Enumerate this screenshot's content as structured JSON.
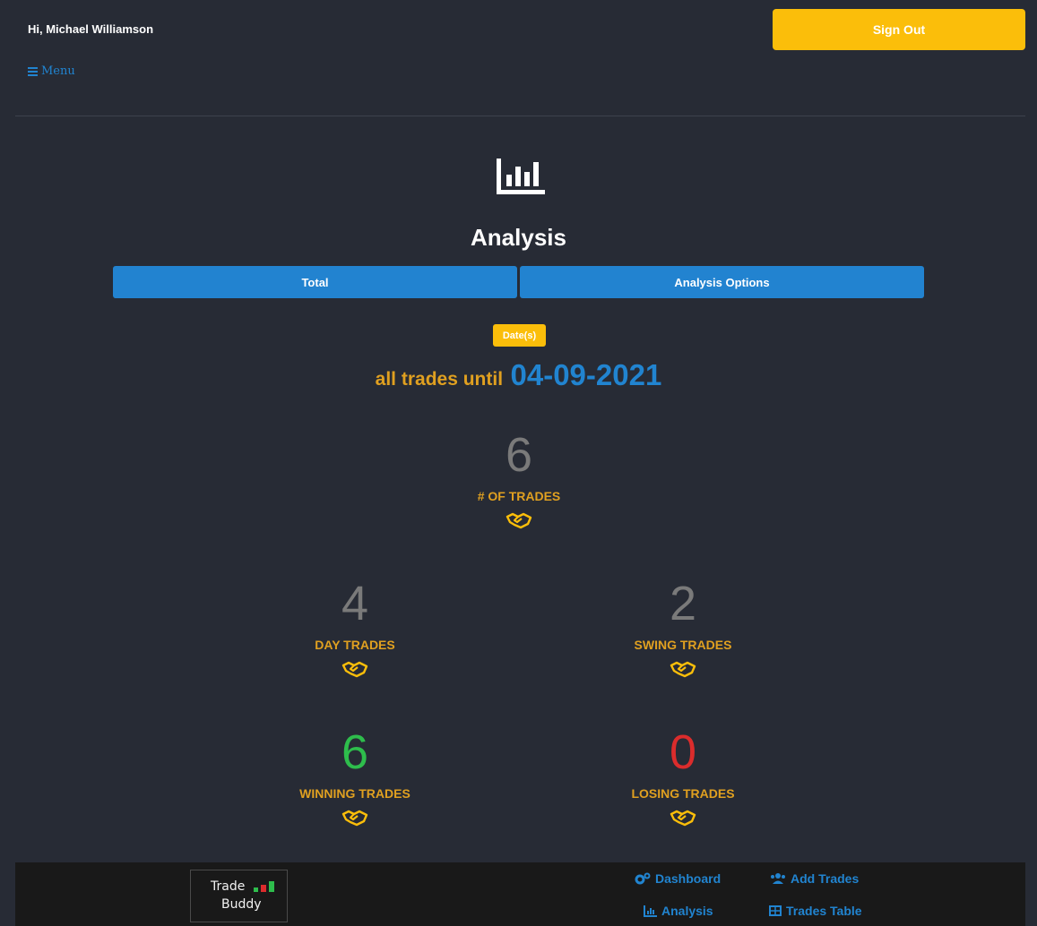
{
  "header": {
    "greeting": "Hi, Michael Williamson",
    "sign_out_label": "Sign Out",
    "menu_label": "Menu"
  },
  "page": {
    "title": "Analysis",
    "tabs": [
      {
        "label": "Total"
      },
      {
        "label": "Analysis Options"
      }
    ],
    "dates_badge": "Date(s)",
    "until_prefix": "all trades until",
    "until_date": "04-09-2021"
  },
  "stats": {
    "total": {
      "value": "6",
      "label": "# OF TRADES"
    },
    "day": {
      "value": "4",
      "label": "DAY TRADES"
    },
    "swing": {
      "value": "2",
      "label": "SWING TRADES"
    },
    "winning": {
      "value": "6",
      "label": "WINNING TRADES"
    },
    "losing": {
      "value": "0",
      "label": "LOSING TRADES"
    }
  },
  "footer": {
    "logo_line1": "Trade",
    "logo_line2": "Buddy",
    "links": {
      "dashboard": "Dashboard",
      "add_trades": "Add Trades",
      "analysis": "Analysis",
      "trades_table": "Trades Table"
    }
  },
  "icons": {
    "page": "bar-chart-icon",
    "stat": "handshake-icon",
    "menu": "bars-icon",
    "dashboard": "cogs-icon",
    "add_trades": "users-icon",
    "analysis": "bar-chart-icon",
    "trades_table": "table-icon"
  },
  "colors": {
    "background": "#272b35",
    "accent_yellow": "#fbbe0a",
    "accent_blue": "#2283d0",
    "label_orange": "#e0a020",
    "neutral_value": "#7a7a7a",
    "win_value": "#2ebd4c",
    "loss_value": "#db2c2c",
    "footer_bg": "#191919"
  }
}
